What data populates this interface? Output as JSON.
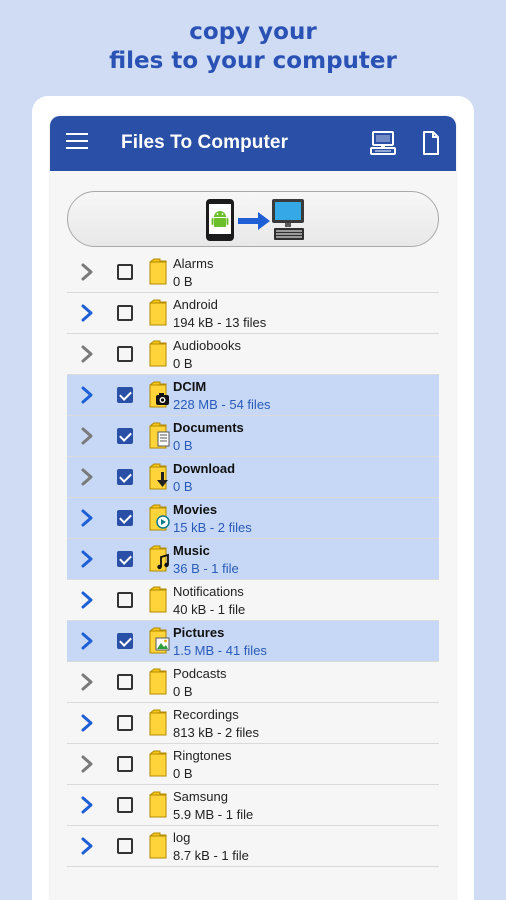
{
  "headline": {
    "line1": "copy your",
    "line2": "files to your computer"
  },
  "appbar": {
    "title": "Files To Computer",
    "background": "#2a4fa6",
    "icons": [
      "menu-icon",
      "computer-icon",
      "file-icon"
    ]
  },
  "transfer_button": {
    "icons": [
      "android-phone-icon",
      "arrow-right-icon",
      "desktop-computer-icon"
    ]
  },
  "colors": {
    "accent": "#2a4fa6",
    "selected_row": "#c6d8f6",
    "selected_info": "#2a5bb8",
    "folder": "#f5c518"
  },
  "folders": [
    {
      "name": "Alarms",
      "info": "0 B",
      "checked": false,
      "selected": false,
      "chevron": "gray",
      "badge": ""
    },
    {
      "name": "Android",
      "info": "194 kB - 13 files",
      "checked": false,
      "selected": false,
      "chevron": "blue",
      "badge": ""
    },
    {
      "name": "Audiobooks",
      "info": "0 B",
      "checked": false,
      "selected": false,
      "chevron": "gray",
      "badge": ""
    },
    {
      "name": "DCIM",
      "info": "228 MB - 54 files",
      "checked": true,
      "selected": true,
      "chevron": "blue",
      "badge": "camera"
    },
    {
      "name": "Documents",
      "info": "0 B",
      "checked": true,
      "selected": true,
      "chevron": "gray",
      "badge": "document"
    },
    {
      "name": "Download",
      "info": "0 B",
      "checked": true,
      "selected": true,
      "chevron": "gray",
      "badge": "download"
    },
    {
      "name": "Movies",
      "info": "15 kB - 2 files",
      "checked": true,
      "selected": true,
      "chevron": "blue",
      "badge": "play"
    },
    {
      "name": "Music",
      "info": "36 B - 1 file",
      "checked": true,
      "selected": true,
      "chevron": "blue",
      "badge": "music"
    },
    {
      "name": "Notifications",
      "info": "40 kB - 1 file",
      "checked": false,
      "selected": false,
      "chevron": "blue",
      "badge": ""
    },
    {
      "name": "Pictures",
      "info": "1.5 MB - 41 files",
      "checked": true,
      "selected": true,
      "chevron": "blue",
      "badge": "image"
    },
    {
      "name": "Podcasts",
      "info": "0 B",
      "checked": false,
      "selected": false,
      "chevron": "gray",
      "badge": ""
    },
    {
      "name": "Recordings",
      "info": "813 kB - 2 files",
      "checked": false,
      "selected": false,
      "chevron": "blue",
      "badge": ""
    },
    {
      "name": "Ringtones",
      "info": "0 B",
      "checked": false,
      "selected": false,
      "chevron": "gray",
      "badge": ""
    },
    {
      "name": "Samsung",
      "info": "5.9 MB - 1 file",
      "checked": false,
      "selected": false,
      "chevron": "blue",
      "badge": ""
    },
    {
      "name": "log",
      "info": "8.7 kB - 1 file",
      "checked": false,
      "selected": false,
      "chevron": "blue",
      "badge": ""
    }
  ]
}
